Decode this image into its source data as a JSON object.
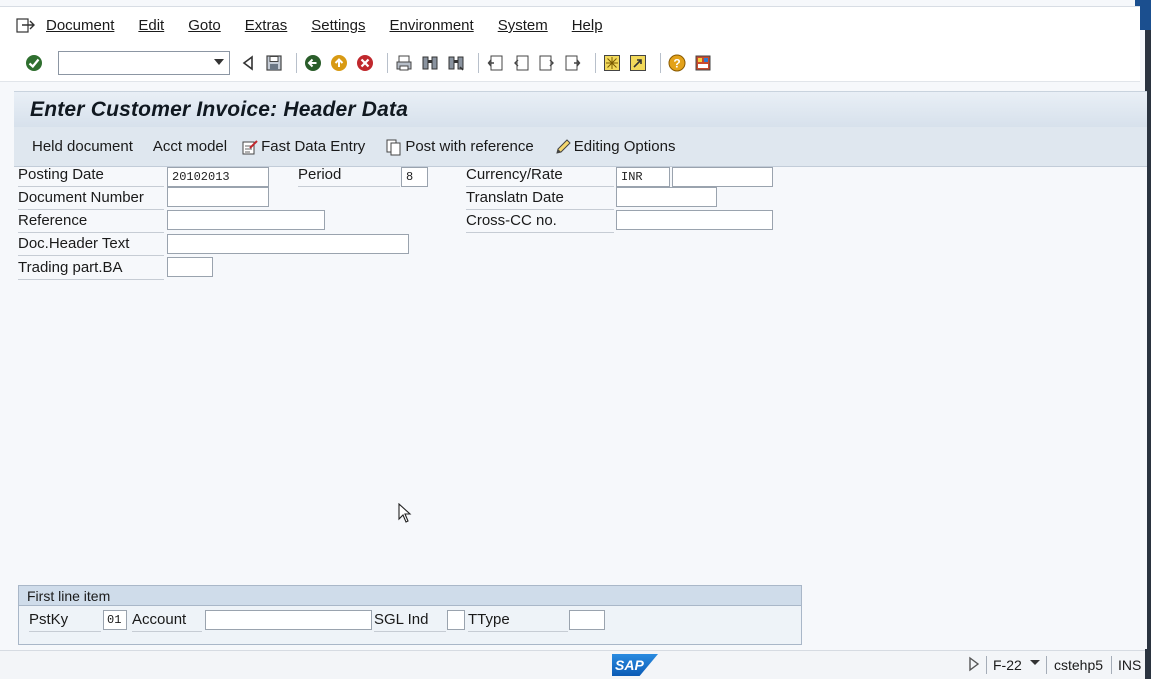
{
  "menu": {
    "items": [
      {
        "label": "Document"
      },
      {
        "label": "Edit"
      },
      {
        "label": "Goto"
      },
      {
        "label": "Extras"
      },
      {
        "label": "Settings"
      },
      {
        "label": "Environment"
      },
      {
        "label": "System"
      },
      {
        "label": "Help"
      }
    ]
  },
  "toolbar": {
    "command_field_value": "",
    "icons": [
      "enter-icon",
      "back-triangle-icon",
      "save-icon",
      "back-icon",
      "exit-icon",
      "cancel-icon",
      "print-icon",
      "find-icon",
      "find-next-icon",
      "first-page-icon",
      "previous-page-icon",
      "next-page-icon",
      "last-page-icon",
      "create-session-icon",
      "shortcut-icon",
      "help-icon",
      "customize-layout-icon"
    ]
  },
  "title": "Enter Customer Invoice: Header Data",
  "app_toolbar": {
    "held_document": "Held document",
    "acct_model": "Acct model",
    "fast_data_entry": "Fast Data Entry",
    "post_with_reference": "Post with reference",
    "editing_options": "Editing Options"
  },
  "form": {
    "posting_date_label": "Posting Date",
    "posting_date_value": "20102013",
    "period_label": "Period",
    "period_value": "8",
    "currency_label": "Currency/Rate",
    "currency_value": "INR",
    "rate_value": "",
    "document_number_label": "Document Number",
    "document_number_value": "",
    "translatn_date_label": "Translatn Date",
    "translatn_date_value": "",
    "reference_label": "Reference",
    "reference_value": "",
    "cross_cc_label": "Cross-CC no.",
    "cross_cc_value": "",
    "doc_header_text_label": "Doc.Header Text",
    "doc_header_text_value": "",
    "trading_part_label": "Trading part.BA",
    "trading_part_value": ""
  },
  "first_line_item": {
    "title": "First line item",
    "pstky_label": "PstKy",
    "pstky_value": "01",
    "account_label": "Account",
    "account_value": "",
    "sgl_ind_label": "SGL Ind",
    "sgl_ind_value": "",
    "ttype_label": "TType",
    "ttype_value": ""
  },
  "status_bar": {
    "logo_text": "SAP",
    "transaction": "F-22",
    "server": "cstehp5",
    "mode": "INS"
  }
}
